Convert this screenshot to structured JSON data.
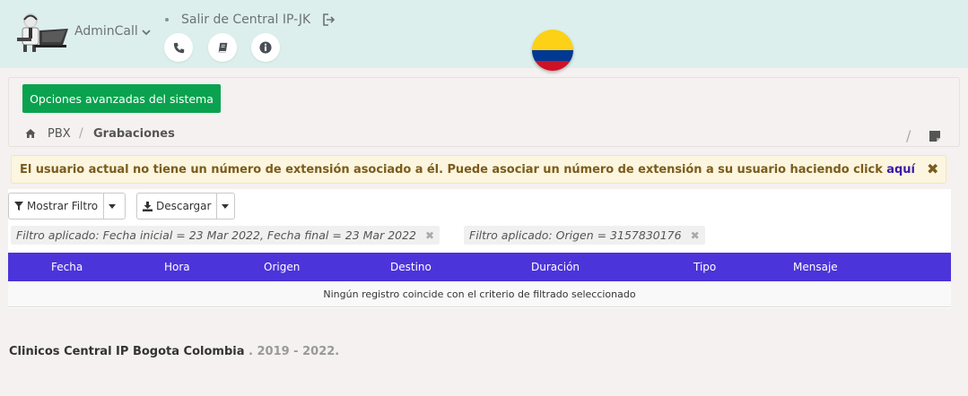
{
  "header": {
    "user_name": "AdminCall",
    "logout_label": "Salir de Central IP-JK",
    "icons": [
      "phone-icon",
      "book-icon",
      "info-icon"
    ],
    "flag_colors": [
      "#fcd116",
      "#003893",
      "#ce1126"
    ]
  },
  "toolbar": {
    "advanced_button": "Opciones avanzadas del sistema"
  },
  "breadcrumb": {
    "items": [
      "PBX",
      "Grabaciones"
    ]
  },
  "alert": {
    "message": "El usuario actual no tiene un número de extensión asociado a él. Puede asociar un número de extensión a su usuario haciendo click ",
    "link": "aquí",
    "close": "✖"
  },
  "filters": {
    "show_filter": "Mostrar Filtro",
    "download": "Descargar",
    "applied": [
      "Filtro aplicado: Fecha inicial = 23 Mar 2022, Fecha final = 23 Mar 2022",
      "Filtro aplicado: Origen = 3157830176"
    ]
  },
  "table": {
    "columns": [
      "Fecha",
      "Hora",
      "Origen",
      "Destino",
      "Duración",
      "Tipo",
      "Mensaje"
    ],
    "empty_message": "Ningún registro coincide con el criterio de filtrado seleccionado"
  },
  "footer": {
    "company": "Clinicos Central IP Bogota Colombia",
    "years": " . 2019 - 2022."
  },
  "colors": {
    "header_bg": "#dcefec",
    "primary_button": "#0aa24f",
    "table_header": "#4b34d9",
    "alert_bg": "#fcf5df"
  }
}
